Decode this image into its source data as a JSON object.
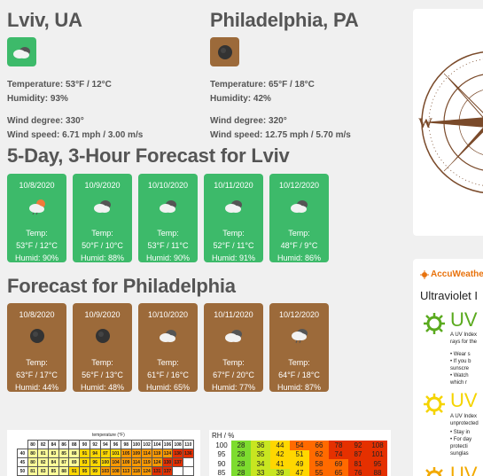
{
  "lviv": {
    "name": "Lviv, UA",
    "temperature": "Temperature: 53°F / 12°C",
    "humidity": "Humidity: 93%",
    "wind_degree": "Wind degree: 330°",
    "wind_speed": "Wind speed: 6.71 mph / 3.00 m/s",
    "color": "#3dba6a"
  },
  "philadelphia": {
    "name": "Philadelphia, PA",
    "temperature": "Temperature: 65°F / 18°C",
    "humidity": "Humidity: 42%",
    "wind_degree": "Wind degree: 320°",
    "wind_speed": "Wind speed: 12.75 mph / 5.70 m/s",
    "color": "#9c6a3a"
  },
  "forecast_lviv": {
    "title": "5-Day, 3-Hour Forecast for Lviv",
    "cards": [
      {
        "date": "10/8/2020",
        "icon": "cloud-sun-icon",
        "temp_label": "Temp:",
        "temp": "53°F / 12°C",
        "humid": "Humid: 90%"
      },
      {
        "date": "10/9/2020",
        "icon": "cloudy-icon",
        "temp_label": "Temp:",
        "temp": "50°F / 10°C",
        "humid": "Humid: 88%"
      },
      {
        "date": "10/10/2020",
        "icon": "cloudy-icon",
        "temp_label": "Temp:",
        "temp": "53°F / 11°C",
        "humid": "Humid: 90%"
      },
      {
        "date": "10/11/2020",
        "icon": "cloudy-icon",
        "temp_label": "Temp:",
        "temp": "52°F / 11°C",
        "humid": "Humid: 91%"
      },
      {
        "date": "10/12/2020",
        "icon": "cloudy-icon",
        "temp_label": "Temp:",
        "temp": "48°F / 9°C",
        "humid": "Humid: 86%"
      }
    ]
  },
  "forecast_philadelphia": {
    "title": "Forecast for Philadelphia",
    "cards": [
      {
        "date": "10/8/2020",
        "icon": "dark-cloud-icon",
        "temp_label": "Temp:",
        "temp": "63°F / 17°C",
        "humid": "Humid: 44%"
      },
      {
        "date": "10/9/2020",
        "icon": "dark-cloud-icon",
        "temp_label": "Temp:",
        "temp": "56°F / 13°C",
        "humid": "Humid: 48%"
      },
      {
        "date": "10/10/2020",
        "icon": "cloudy-icon",
        "temp_label": "Temp:",
        "temp": "61°F / 16°C",
        "humid": "Humid: 65%"
      },
      {
        "date": "10/11/2020",
        "icon": "cloudy-icon",
        "temp_label": "Temp:",
        "temp": "67°F / 20°C",
        "humid": "Humid: 77%"
      },
      {
        "date": "10/12/2020",
        "icon": "rain-cloud-icon",
        "temp_label": "Temp:",
        "temp": "64°F / 18°C",
        "humid": "Humid: 87%"
      }
    ]
  },
  "uv_panel": {
    "brand": "AccuWeathe",
    "title": "Ultraviolet I",
    "sections": [
      {
        "head": "UV I",
        "text": [
          "A UV Index",
          "rays for the",
          "• Wear s",
          "• If you b",
          "  sunscre",
          "• Watch",
          "  which r"
        ]
      },
      {
        "head": "UV I",
        "text": [
          "A UV Index",
          "unprotected",
          "• Stay in",
          "• For day",
          "  protecti",
          "  sunglas"
        ]
      },
      {
        "head": "UV I",
        "text": []
      }
    ]
  },
  "heat_index": {
    "caption": "temperature (°F)",
    "header": [
      "80",
      "82",
      "84",
      "86",
      "88",
      "90",
      "92",
      "94",
      "96",
      "98",
      "100",
      "102",
      "104",
      "106",
      "108",
      "110"
    ],
    "rows": [
      {
        "label": "40",
        "values": [
          "80",
          "81",
          "83",
          "85",
          "88",
          "91",
          "94",
          "97",
          "101",
          "105",
          "109",
          "114",
          "119",
          "124",
          "130",
          "136"
        ]
      },
      {
        "label": "45",
        "values": [
          "80",
          "82",
          "84",
          "87",
          "89",
          "93",
          "96",
          "100",
          "104",
          "109",
          "114",
          "119",
          "124",
          "130",
          "137",
          ""
        ]
      },
      {
        "label": "50",
        "values": [
          "81",
          "83",
          "85",
          "88",
          "91",
          "95",
          "99",
          "103",
          "108",
          "113",
          "118",
          "124",
          "131",
          "137",
          "",
          ""
        ]
      }
    ]
  },
  "rh_table": {
    "caption": "RH / %",
    "rows": [
      {
        "label": "100",
        "values": [
          "28",
          "36",
          "44",
          "54",
          "66",
          "78",
          "92",
          "108"
        ]
      },
      {
        "label": "95",
        "values": [
          "28",
          "35",
          "42",
          "51",
          "62",
          "74",
          "87",
          "101"
        ]
      },
      {
        "label": "90",
        "values": [
          "28",
          "34",
          "41",
          "49",
          "58",
          "69",
          "81",
          "95"
        ]
      },
      {
        "label": "85",
        "values": [
          "28",
          "33",
          "39",
          "47",
          "55",
          "65",
          "76",
          "88"
        ]
      }
    ]
  }
}
